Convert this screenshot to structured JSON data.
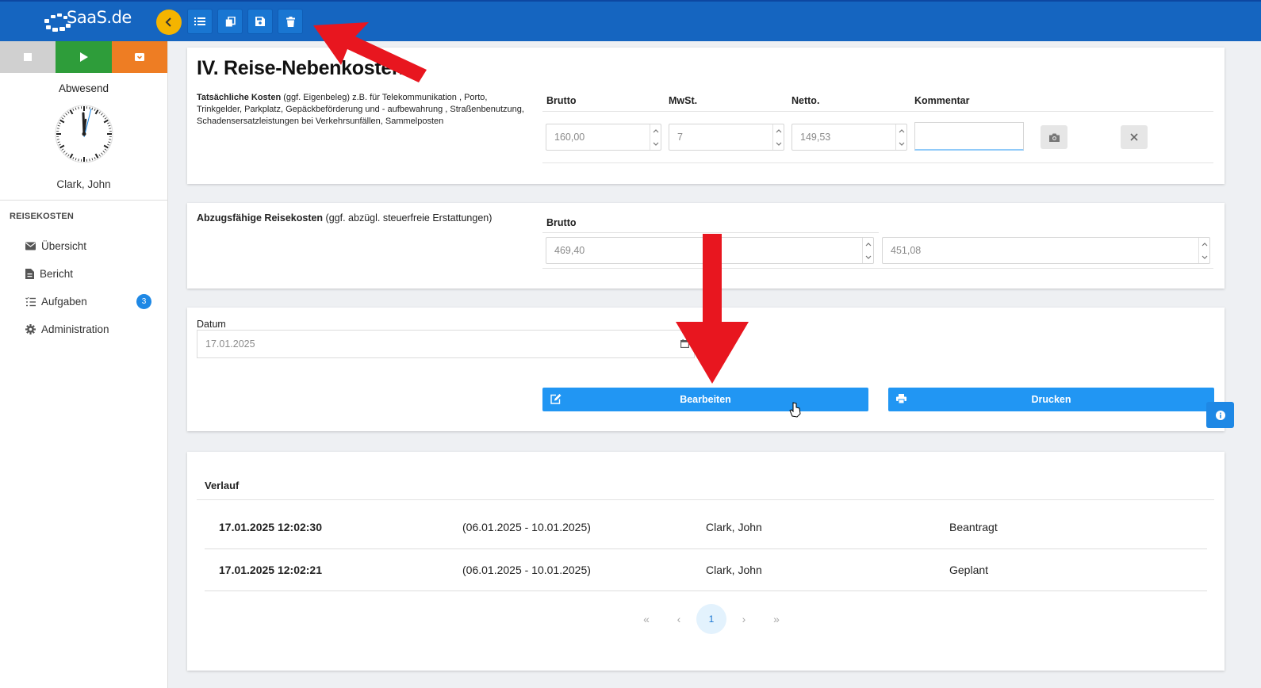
{
  "header": {
    "logo_text": "SaaS.de",
    "toolbar_icons": [
      "list-icon",
      "copy-icon",
      "save-icon",
      "trash-icon"
    ],
    "brand_color": "#1565c0"
  },
  "sidebar": {
    "status_label": "Abwesend",
    "user_name": "Clark, John",
    "section_title": "REISEKOSTEN",
    "items": [
      {
        "label": "Übersicht",
        "icon": "envelope-icon"
      },
      {
        "label": "Bericht",
        "icon": "file-icon"
      },
      {
        "label": "Aufgaben",
        "icon": "task-list-icon",
        "badge": "3"
      },
      {
        "label": "Administration",
        "icon": "gear-icon"
      }
    ]
  },
  "nebenkosten": {
    "title": "IV. Reise-Nebenkosten",
    "desc_bold": "Tatsächliche Kosten",
    "desc_rest": " (ggf. Eigenbeleg) z.B. für Telekommunikation , Porto, Trinkgelder, Parkplatz, Gepäckbeförderung und - aufbewahrung , Straßenbenutzung, Schadensersatzleistungen bei Verkehrsunfällen, Sammelposten",
    "col_brutto": "Brutto",
    "col_mwst": "MwSt.",
    "col_netto": "Netto.",
    "col_kommentar": "Kommentar",
    "brutto": "160,00",
    "mwst": "7",
    "netto": "149,53",
    "kommentar": ""
  },
  "abzugsfaehig": {
    "label_bold": "Abzugsfähige Reisekosten",
    "label_rest": " (ggf. abzügl. steuerfreie Erstattungen)",
    "col_brutto": "Brutto",
    "brutto": "469,40",
    "netto": "451,08"
  },
  "datum": {
    "label": "Datum",
    "value": "17.01.2025",
    "edit_label": "Bearbeiten",
    "print_label": "Drucken"
  },
  "verlauf": {
    "title": "Verlauf",
    "rows": [
      {
        "timestamp": "17.01.2025 12:02:30",
        "period": "(06.01.2025 - 10.01.2025)",
        "user": "Clark, John",
        "status": "Beantragt"
      },
      {
        "timestamp": "17.01.2025 12:02:21",
        "period": "(06.01.2025 - 10.01.2025)",
        "user": "Clark, John",
        "status": "Geplant"
      }
    ],
    "pagination": {
      "first": "«",
      "prev": "‹",
      "current": "1",
      "next": "›",
      "last": "»"
    }
  },
  "colors": {
    "accent": "#2196f3",
    "play": "#2e9d3a",
    "break": "#ee7d23",
    "annotation_arrow": "#e8161f"
  }
}
